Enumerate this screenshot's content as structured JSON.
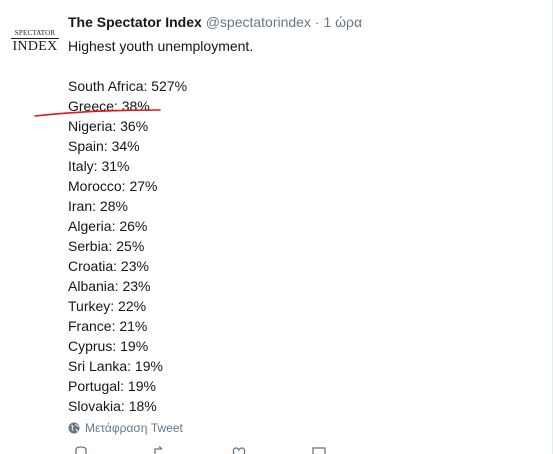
{
  "author": {
    "avatar_top": "SPECTATOR",
    "avatar_bottom": "INDEX",
    "name": "The Spectator Index",
    "handle": "@spectatorindex",
    "separator": "·",
    "time": "1 ώρα"
  },
  "tweet": {
    "intro": "Highest youth unemployment.",
    "lines": [
      "South Africa: 527%",
      "Greece: 38%",
      "Nigeria: 36%",
      "Spain: 34%",
      "Italy: 31%",
      "Morocco: 27%",
      "Iran: 28%",
      "Algeria: 26%",
      "Serbia: 25%",
      "Croatia: 23%",
      "Albania: 23%",
      "Turkey: 22%",
      "France: 21%",
      "Cyprus: 19%",
      "Sri Lanka: 19%",
      "Portugal: 19%",
      "Slovakia: 18%"
    ]
  },
  "translate_label": "Μετάφραση Tweet",
  "colors": {
    "text": "#14171a",
    "muted": "#657786",
    "annotation": "#e0191e"
  },
  "icons": {
    "globe": "globe-icon",
    "reply": "reply-icon",
    "retweet": "retweet-icon",
    "like": "heart-icon",
    "message": "message-icon"
  }
}
